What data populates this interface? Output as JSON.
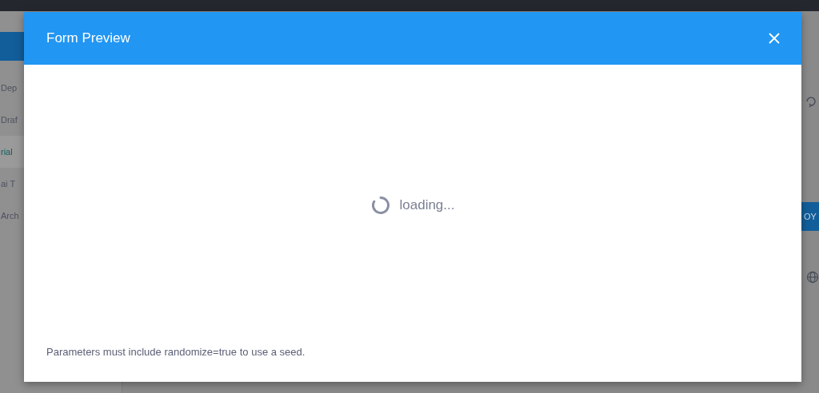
{
  "background": {
    "sidebar_items": [
      {
        "label": "Dep",
        "selected": false
      },
      {
        "label": "Draf",
        "selected": false
      },
      {
        "label": "rial",
        "selected": true
      },
      {
        "label": "ai T",
        "selected": false
      },
      {
        "label": "Arch",
        "selected": false
      }
    ],
    "action_button": "OY"
  },
  "dialog": {
    "title": "Form Preview",
    "status": "loading...",
    "note": "Parameters must include randomize=true to use a seed."
  }
}
